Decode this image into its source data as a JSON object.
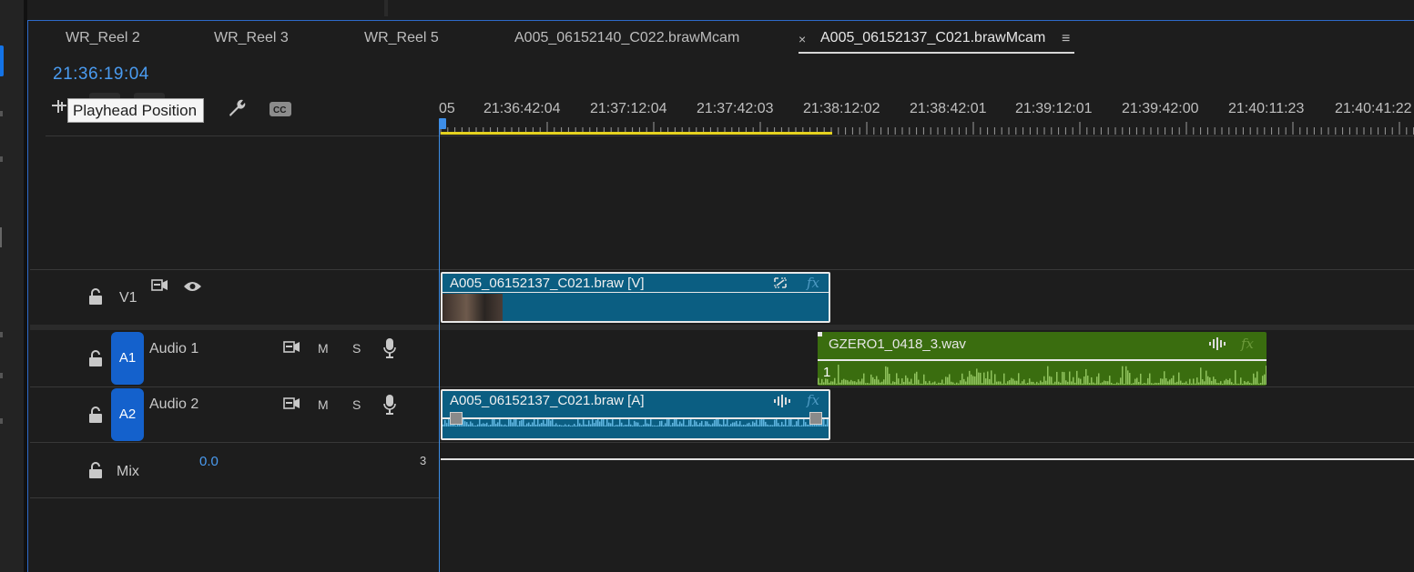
{
  "tabs": [
    {
      "label": "WR_Reel 2"
    },
    {
      "label": "WR_Reel 3"
    },
    {
      "label": "WR_Reel 5"
    },
    {
      "label": "A005_06152140_C022.brawMcam"
    },
    {
      "label": "A005_06152137_C021.brawMcam",
      "active": true
    }
  ],
  "active_tab_close": "×",
  "panel_menu": "≡",
  "timecode": "21:36:19:04",
  "tooltip": "Playhead Position",
  "ruler": {
    "labels": [
      "05",
      "21:36:42:04",
      "21:37:12:04",
      "21:37:42:03",
      "21:38:12:02",
      "21:38:42:01",
      "21:39:12:01",
      "21:39:42:00",
      "21:40:11:23",
      "21:40:41:22"
    ]
  },
  "tracks": {
    "v1": {
      "label": "V1"
    },
    "a1": {
      "badge": "A1",
      "name": "Audio 1",
      "m": "M",
      "s": "S"
    },
    "a2": {
      "badge": "A2",
      "name": "Audio 2",
      "m": "M",
      "s": "S"
    },
    "mix": {
      "name": "Mix",
      "value": "0.0",
      "end_marker": "3"
    }
  },
  "clips": {
    "video": {
      "name": "A005_06152137_C021.braw [V]",
      "fx": "fx"
    },
    "audio1": {
      "name": "GZERO1_0418_3.wav",
      "fx": "fx",
      "channel": "1"
    },
    "audio2": {
      "name": "A005_06152137_C021.braw [A]",
      "fx": "fx"
    }
  },
  "icons": [
    "settings-icon",
    "wrench-icon",
    "captions-icon",
    "lock-icon",
    "source-patch-icon",
    "eye-icon",
    "microphone-icon",
    "waveform-icon",
    "link-icon"
  ],
  "colors": {
    "accent": "#1473e6",
    "timecode": "#4a9bf0",
    "video_clip": "#0b5e82",
    "audio_clip_green": "#3a6d0f",
    "work_area": "#e5d21f"
  }
}
